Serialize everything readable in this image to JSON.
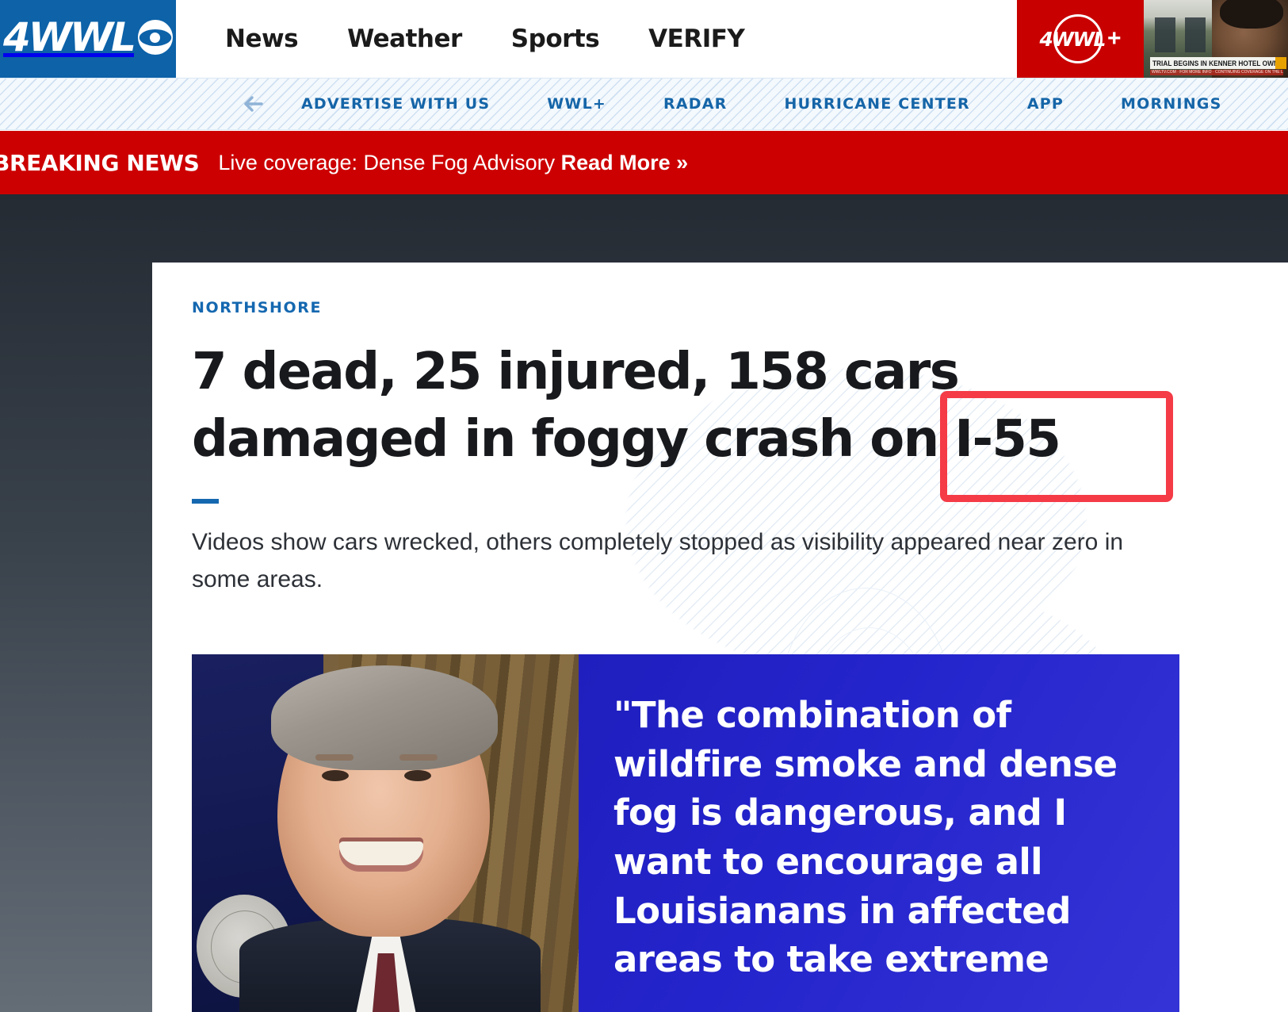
{
  "header": {
    "logo": {
      "text": "4WWL",
      "icon": "cbs-eye-icon",
      "bg_color": "#0d62a8"
    },
    "nav": [
      {
        "label": "News"
      },
      {
        "label": "Weather"
      },
      {
        "label": "Sports"
      },
      {
        "label": "VERIFY"
      }
    ],
    "promo": {
      "brand": "4WWL",
      "plus": "+",
      "bg_color": "#c80000",
      "thumbnail": {
        "chyron": "TRIAL BEGINS IN KENNER HOTEL OWNER KILLING",
        "subline": "WWLTV.COM · FOR MORE INFO · CONTINUING COVERAGE ON THE LATEST HEADLINES UPDATES"
      }
    }
  },
  "subnav": {
    "back_icon": "arrow-left-icon",
    "items": [
      {
        "label": "ADVERTISE WITH US"
      },
      {
        "label": "WWL+"
      },
      {
        "label": "RADAR"
      },
      {
        "label": "HURRICANE CENTER"
      },
      {
        "label": "APP"
      },
      {
        "label": "MORNINGS"
      }
    ]
  },
  "breaking": {
    "label": "BREAKING NEWS",
    "text": "Live coverage: Dense Fog Advisory ",
    "link": "Read More »",
    "bg_color": "#cc0000"
  },
  "article": {
    "kicker": "NORTHSHORE",
    "headline": "7 dead, 25 injured, 158 cars damaged in foggy crash on I-55",
    "dek": "Videos show cars wrecked, others completely stopped as visibility appeared near zero in some areas.",
    "highlight_term": "I-55",
    "annotation_color": "#f43b46"
  },
  "quote_card": {
    "quote": "\"The combination of wildfire smoke and dense fog is dangerous, and I want to encourage all Louisianans in affected areas to take extreme",
    "bg_color": "#2424cc",
    "photo_alt": "portrait-of-official"
  }
}
